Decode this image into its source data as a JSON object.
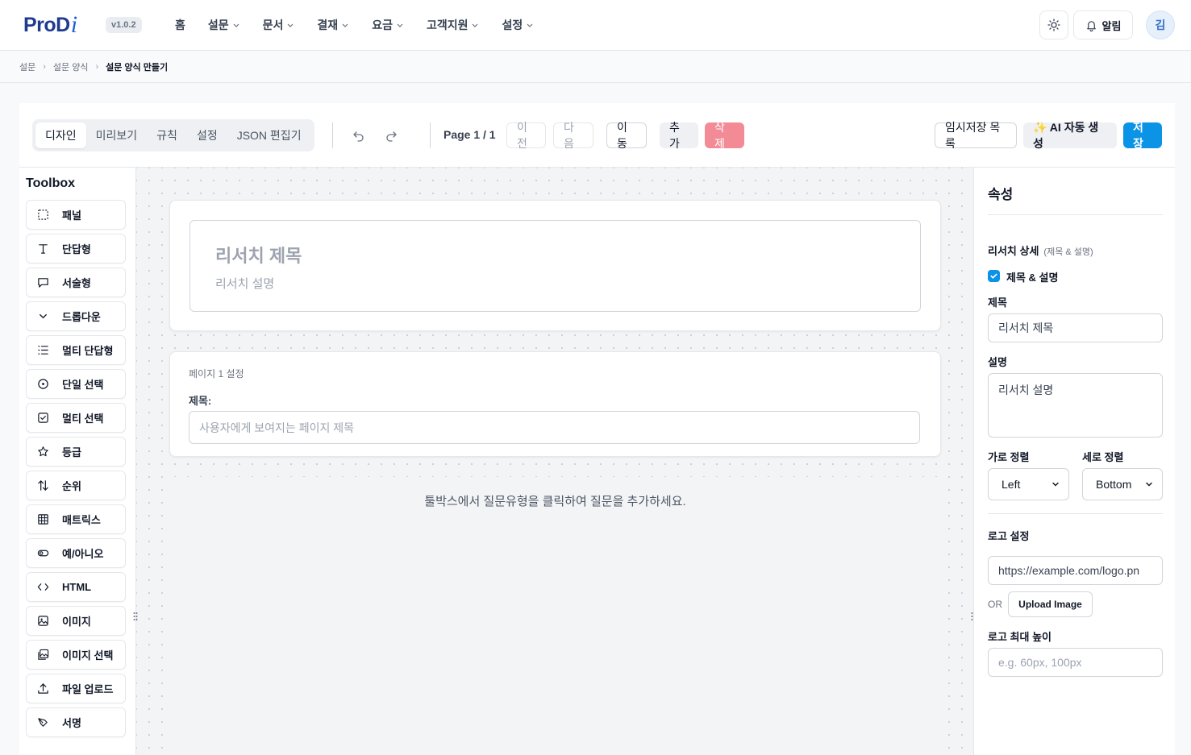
{
  "header": {
    "logo_main": "ProD",
    "logo_accent": "i",
    "version": "v1.0.2",
    "nav": [
      {
        "label": "홈",
        "has_dropdown": false
      },
      {
        "label": "설문",
        "has_dropdown": true
      },
      {
        "label": "문서",
        "has_dropdown": true
      },
      {
        "label": "결재",
        "has_dropdown": true
      },
      {
        "label": "요금",
        "has_dropdown": true
      },
      {
        "label": "고객지원",
        "has_dropdown": true
      },
      {
        "label": "설정",
        "has_dropdown": true
      }
    ],
    "theme_icon": "sun-icon",
    "notifications_label": "알림",
    "avatar_initial": "김"
  },
  "breadcrumb": [
    "설문",
    "설문 양식",
    "설문 양식 만들기"
  ],
  "toolbar": {
    "tabs": [
      "디자인",
      "미리보기",
      "규칙",
      "설정",
      "JSON 편집기"
    ],
    "active_tab": "디자인",
    "page_label": "Page 1 / 1",
    "prev_label": "이전",
    "next_label": "다음",
    "move_label": "이동",
    "add_label": "추가",
    "delete_label": "삭제",
    "drafts_label": "임시저장 목록",
    "ai_label": "✨ AI 자동 생성",
    "save_label": "저장"
  },
  "toolbox": {
    "title": "Toolbox",
    "items": [
      {
        "label": "패널",
        "icon": "panel-icon"
      },
      {
        "label": "단답형",
        "icon": "text-icon"
      },
      {
        "label": "서술형",
        "icon": "comment-icon"
      },
      {
        "label": "드롭다운",
        "icon": "chevron-down-icon"
      },
      {
        "label": "멀티 단답형",
        "icon": "list-icon"
      },
      {
        "label": "단일 선택",
        "icon": "radio-icon"
      },
      {
        "label": "멀티 선택",
        "icon": "checkbox-icon"
      },
      {
        "label": "등급",
        "icon": "star-icon"
      },
      {
        "label": "순위",
        "icon": "sort-icon"
      },
      {
        "label": "매트릭스",
        "icon": "grid-icon"
      },
      {
        "label": "예/아니오",
        "icon": "toggle-icon"
      },
      {
        "label": "HTML",
        "icon": "code-icon"
      },
      {
        "label": "이미지",
        "icon": "image-icon"
      },
      {
        "label": "이미지 선택",
        "icon": "images-icon"
      },
      {
        "label": "파일 업로드",
        "icon": "upload-icon"
      },
      {
        "label": "서명",
        "icon": "signature-icon"
      }
    ]
  },
  "canvas": {
    "survey_title_placeholder": "리서치 제목",
    "survey_desc_placeholder": "리서치 설명",
    "page_settings_label": "페이지 1 설정",
    "page_title_label": "제목:",
    "page_title_placeholder": "사용자에게 보여지는 페이지 제목",
    "empty_hint": "툴박스에서 질문유형을 클릭하여 질문을 추가하세요."
  },
  "properties": {
    "title": "속성",
    "research_detail_label": "리서치 상세",
    "research_detail_sub": "(제목 & 설명)",
    "checkbox_label": "제목 & 설명",
    "checkbox_checked": true,
    "title_label": "제목",
    "title_value": "리서치 제목",
    "desc_label": "설명",
    "desc_value": "리서치 설명",
    "h_align_label": "가로 정렬",
    "h_align_value": "Left",
    "v_align_label": "세로 정렬",
    "v_align_value": "Bottom",
    "logo_label": "로고 설정",
    "logo_url": "https://example.com/logo.pn",
    "or_label": "OR",
    "upload_label": "Upload Image",
    "logo_height_label": "로고 최대 높이",
    "logo_height_placeholder": "e.g. 60px, 100px"
  },
  "colors": {
    "primary": "#0b93e6",
    "danger": "#f28b95",
    "logo_dark": "#1f3a8f",
    "logo_accent": "#1d5fd6"
  }
}
